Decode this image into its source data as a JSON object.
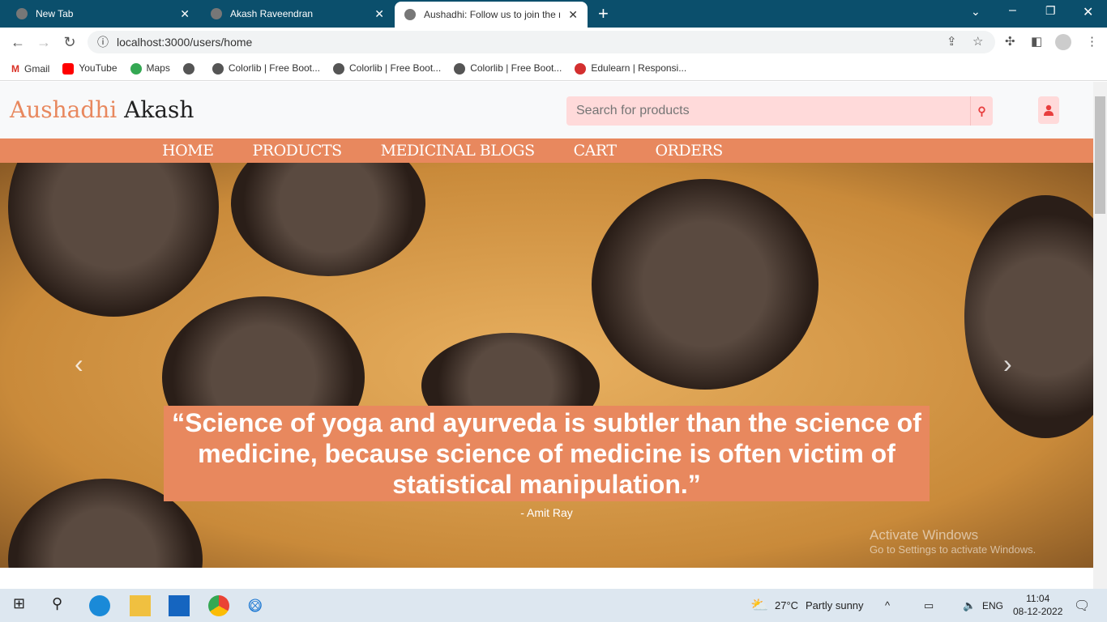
{
  "browser": {
    "tabs": [
      {
        "title": "New Tab"
      },
      {
        "title": "Akash Raveendran"
      },
      {
        "title": "Aushadhi: Follow us to join the n"
      }
    ],
    "url": "localhost:3000/users/home",
    "bookmarks": [
      "Gmail",
      "YouTube",
      "Maps",
      "",
      "Colorlib | Free Boot...",
      "Colorlib | Free Boot...",
      "Colorlib | Free Boot...",
      "Edulearn | Responsi..."
    ]
  },
  "site": {
    "logo_part1": "Aushadhi",
    "logo_part2": "Akash",
    "search_placeholder": "Search for products",
    "menu": [
      "HOME",
      "PRODUCTS",
      "MEDICINAL BLOGS",
      "CART",
      "ORDERS"
    ],
    "quote": "“Science of yoga and ayurveda is subtler than the science of medicine, because science of medicine is often victim of statistical manipulation.”",
    "author": "- Amit Ray",
    "accent": "#e8885e"
  },
  "watermark": {
    "title": "Activate Windows",
    "sub": "Go to Settings to activate Windows."
  },
  "taskbar": {
    "weather": "27°C",
    "weather_desc": "Partly sunny",
    "lang": "ENG",
    "time": "11:04",
    "date": "08-12-2022"
  }
}
